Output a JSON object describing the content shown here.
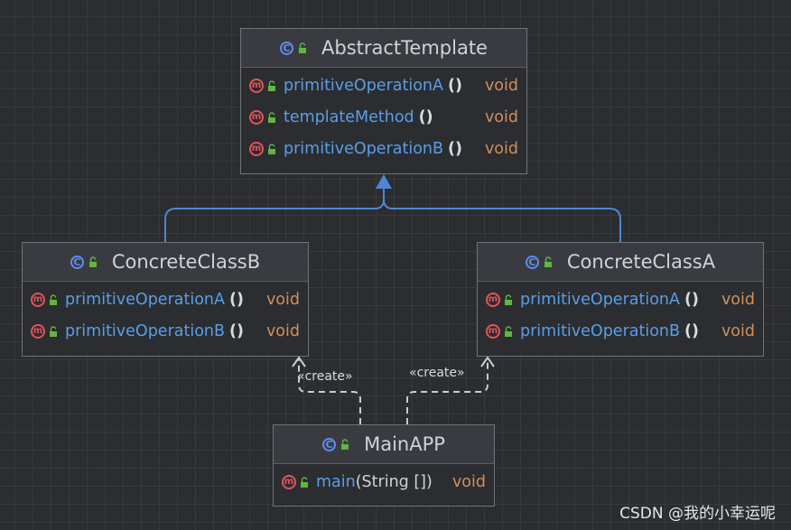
{
  "classes": {
    "abstract_template": {
      "name": "AbstractTemplate",
      "methods": [
        {
          "name": "primitiveOperationA",
          "params": "()",
          "return": "void"
        },
        {
          "name": "templateMethod",
          "params": "()",
          "return": "void"
        },
        {
          "name": "primitiveOperationB",
          "params": "()",
          "return": "void"
        }
      ]
    },
    "concrete_b": {
      "name": "ConcreteClassB",
      "methods": [
        {
          "name": "primitiveOperationA",
          "params": "()",
          "return": "void"
        },
        {
          "name": "primitiveOperationB",
          "params": "()",
          "return": "void"
        }
      ]
    },
    "concrete_a": {
      "name": "ConcreteClassA",
      "methods": [
        {
          "name": "primitiveOperationA",
          "params": "()",
          "return": "void"
        },
        {
          "name": "primitiveOperationB",
          "params": "()",
          "return": "void"
        }
      ]
    },
    "main_app": {
      "name": "MainAPP",
      "methods": [
        {
          "name": "main",
          "params": "(String [])",
          "return": "void"
        }
      ]
    }
  },
  "edges": {
    "create_b_label": "«create»",
    "create_a_label": "«create»"
  },
  "icons": {
    "class_icon": "class-c-icon",
    "method_icon": "method-m-icon",
    "visibility_icon": "public-lock-icon"
  },
  "colors": {
    "background": "#2b2d30",
    "header": "#393b40",
    "method_name": "#5a9ee8",
    "return_type": "#d18f5a",
    "inheritance_edge": "#4f86d6",
    "dependency_edge": "#c9cdd3"
  },
  "watermark": "CSDN @我的小幸运呢"
}
